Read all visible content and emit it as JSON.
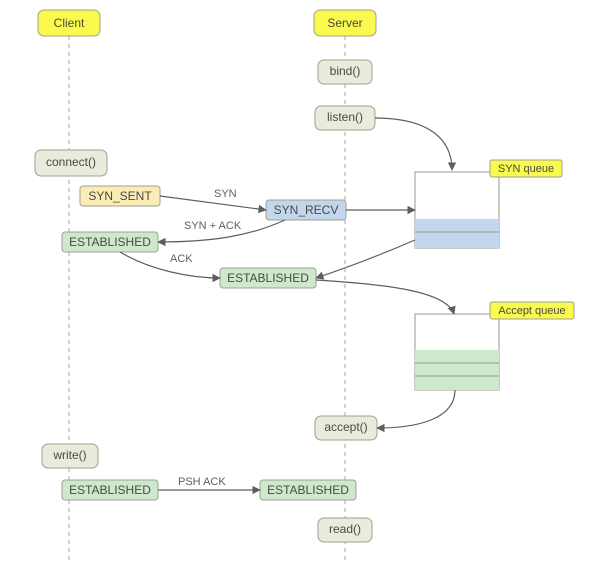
{
  "colors": {
    "header": "#faf94e",
    "call": "#eaeadd",
    "syn_sent": "#f9edb5",
    "syn_recv": "#c2d6ee",
    "est": "#cee8ce",
    "queue_title": "#f9f94e",
    "syn_fill": "#c2d6ee",
    "acc_fill": "#cee8ce"
  },
  "participants": {
    "client": "Client",
    "server": "Server"
  },
  "client_calls": {
    "connect": "connect()",
    "write": "write()"
  },
  "server_calls": {
    "bind": "bind()",
    "listen": "listen()",
    "accept": "accept()",
    "read": "read()"
  },
  "states": {
    "syn_sent": "SYN_SENT",
    "syn_recv": "SYN_RECV",
    "est_c1": "ESTABLISHED",
    "est_s": "ESTABLISHED",
    "est_c2": "ESTABLISHED",
    "est_s2": "ESTABLISHED"
  },
  "edges": {
    "syn": "SYN",
    "synack": "SYN + ACK",
    "ack": "ACK",
    "pshack": "PSH ACK"
  },
  "queues": {
    "syn": "SYN queue",
    "accept": "Accept queue"
  }
}
